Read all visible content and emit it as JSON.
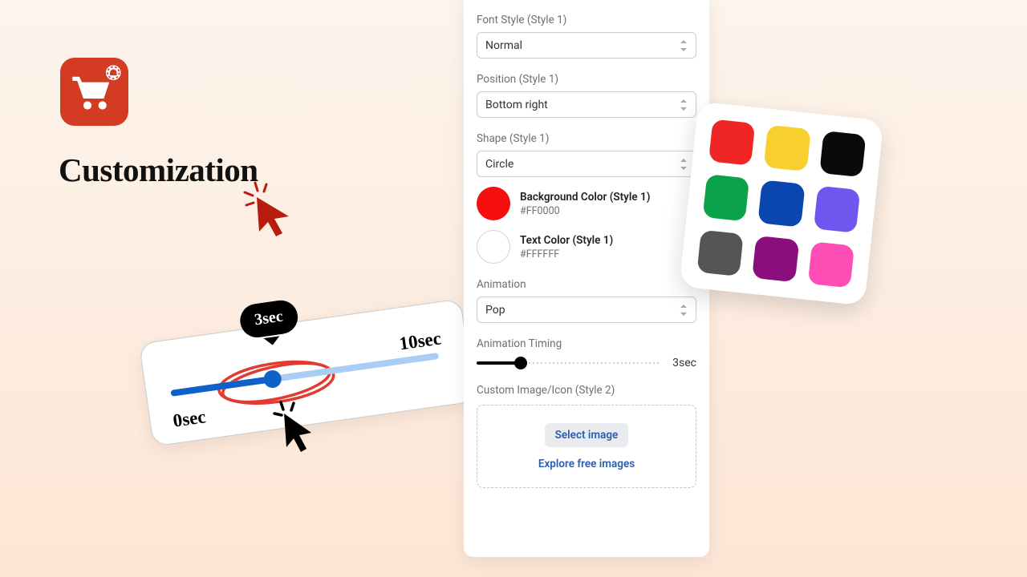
{
  "heading": "Customization",
  "icon_name": "cart-notification-icon",
  "panel": {
    "font_style": {
      "label": "Font Style (Style 1)",
      "value": "Normal"
    },
    "position": {
      "label": "Position (Style 1)",
      "value": "Bottom right"
    },
    "shape": {
      "label": "Shape (Style 1)",
      "value": "Circle"
    },
    "bg_color": {
      "label": "Background Color (Style 1)",
      "hex": "#FF0000"
    },
    "text_color": {
      "label": "Text Color (Style 1)",
      "hex": "#FFFFFF"
    },
    "animation": {
      "label": "Animation",
      "value": "Pop"
    },
    "timing": {
      "label": "Animation Timing",
      "value": "3sec"
    },
    "image": {
      "label": "Custom Image/Icon (Style 2)",
      "select": "Select image",
      "explore": "Explore free images"
    }
  },
  "slider": {
    "min": "0sec",
    "max": "10sec",
    "current": "3sec"
  },
  "palette": [
    "#f02626",
    "#f7cf2f",
    "#0a0a0a",
    "#0aa24a",
    "#0946b0",
    "#6e57ef",
    "#555555",
    "#8a0f7d",
    "#ff4fb6"
  ]
}
